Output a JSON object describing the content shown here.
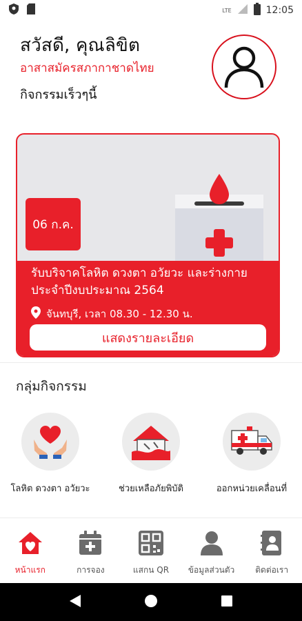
{
  "status_bar": {
    "time": "12:05",
    "network": "LTE",
    "left_icons": [
      "shield-icon",
      "sim-card-icon"
    ]
  },
  "header": {
    "greeting": "สวัสดี, คุณลิขิต",
    "organization": "อาสาสมัครสภากาชาดไทย",
    "recent_title": "กิจกรรมเร็วๆนี้"
  },
  "event_card": {
    "date": "06 ก.ค.",
    "title": "รับบริจาคโลหิต ดวงตา อวัยวะ และร่างกาย ประจำปีงบประมาณ 2564",
    "place": "จันทบุรี, เวลา 08.30 - 12.30 น.",
    "detail_button": "แสดงรายละเอียด"
  },
  "groups": {
    "title": "กลุ่มกิจกรรม",
    "items": [
      {
        "label": "โลหิต ดวงตา อวัยวะ",
        "icon": "heart-hands-icon"
      },
      {
        "label": "ช่วยเหลือภัยพิบัติ",
        "icon": "disaster-house-icon"
      },
      {
        "label": "ออกหน่วยเคลื่อนที่",
        "icon": "ambulance-icon"
      }
    ]
  },
  "bottom_nav": {
    "items": [
      {
        "label": "หน้าแรก",
        "icon": "home-heart-icon",
        "active": true
      },
      {
        "label": "การจอง",
        "icon": "calendar-add-icon",
        "active": false
      },
      {
        "label": "แสกน QR",
        "icon": "qr-code-icon",
        "active": false
      },
      {
        "label": "ข้อมูลส่วนตัว",
        "icon": "person-icon",
        "active": false
      },
      {
        "label": "ติดต่อเรา",
        "icon": "contact-book-icon",
        "active": false
      }
    ]
  },
  "colors": {
    "accent": "#e8202a",
    "card_background": "#e7e7ea",
    "icon_gray": "#6b6b6b"
  }
}
